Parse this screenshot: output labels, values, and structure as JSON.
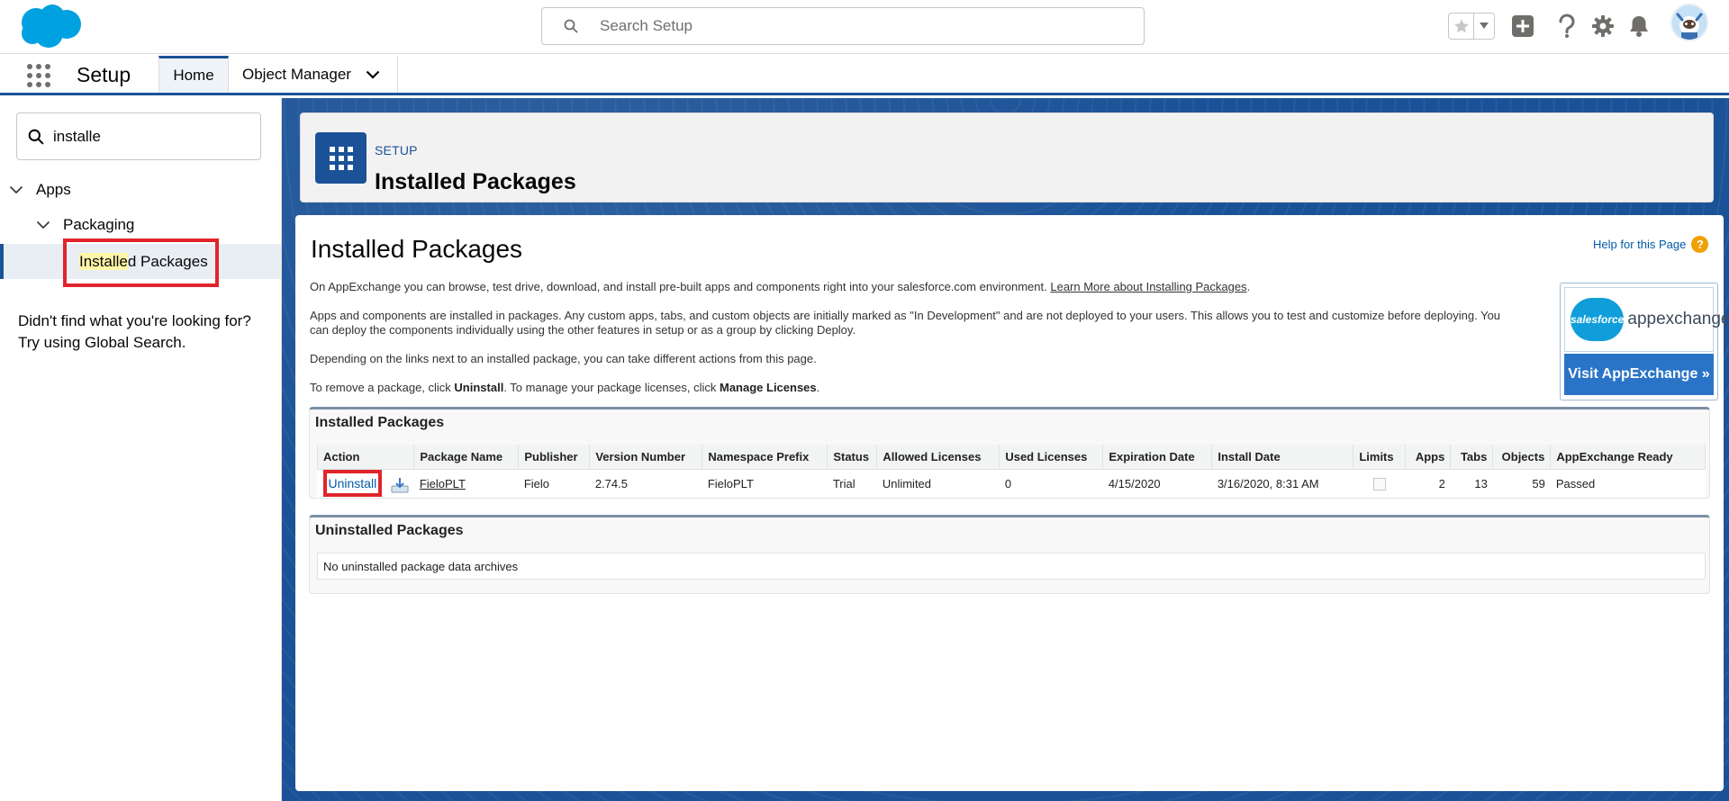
{
  "header": {
    "search_placeholder": "Search Setup"
  },
  "context_bar": {
    "app_name": "Setup",
    "tabs": [
      {
        "label": "Home"
      },
      {
        "label": "Object Manager"
      }
    ]
  },
  "left_panel": {
    "quickfind_value": "installe",
    "tree": {
      "apps": "Apps",
      "packaging": "Packaging",
      "selected_match": "Installe",
      "selected_rest": "d Packages"
    },
    "not_found_line1": "Didn't find what you're looking for?",
    "not_found_line2": "Try using Global Search."
  },
  "page_header": {
    "subtitle": "SETUP",
    "title": "Installed Packages"
  },
  "content": {
    "title": "Installed Packages",
    "help_link": "Help for this Page",
    "para1_text": "On AppExchange you can browse, test drive, download, and install pre-built apps and components right into your salesforce.com environment. ",
    "para1_link": "Learn More about Installing Packages",
    "para2": "Apps and components are installed in packages. Any custom apps, tabs, and custom objects are initially marked as \"In Development\" and are not deployed to your users. This allows you to test and customize before deploying. You can deploy the components individually using the other features in setup or as a group by clicking Deploy.",
    "para3": "Depending on the links next to an installed package, you can take different actions from this page.",
    "para4_a": "To remove a package, click ",
    "para4_b": "Uninstall",
    "para4_c": ". To manage your package licenses, click ",
    "para4_d": "Manage Licenses",
    "para4_e": ".",
    "appexchange": {
      "logo_word": "salesforce",
      "brand": "appexchange",
      "button": "Visit AppExchange »"
    }
  },
  "installed": {
    "section_title": "Installed Packages",
    "columns": [
      "Action",
      "Package Name",
      "Publisher",
      "Version Number",
      "Namespace Prefix",
      "Status",
      "Allowed Licenses",
      "Used Licenses",
      "Expiration Date",
      "Install Date",
      "Limits",
      "Apps",
      "Tabs",
      "Objects",
      "AppExchange Ready"
    ],
    "rows": [
      {
        "action": "Uninstall",
        "package_name": "FieloPLT",
        "publisher": "Fielo",
        "version": "2.74.5",
        "namespace": "FieloPLT",
        "status": "Trial",
        "allowed": "Unlimited",
        "used": "0",
        "expiration": "4/15/2020",
        "install_date": "3/16/2020, 8:31 AM",
        "apps": "2",
        "tabs": "13",
        "objects": "59",
        "ready": "Passed"
      }
    ]
  },
  "uninstalled": {
    "section_title": "Uninstalled Packages",
    "empty_text": "No uninstalled package data archives"
  },
  "colors": {
    "brand_blue": "#1b5297",
    "link_blue": "#015ba7",
    "highlight_red": "#e1242b"
  }
}
